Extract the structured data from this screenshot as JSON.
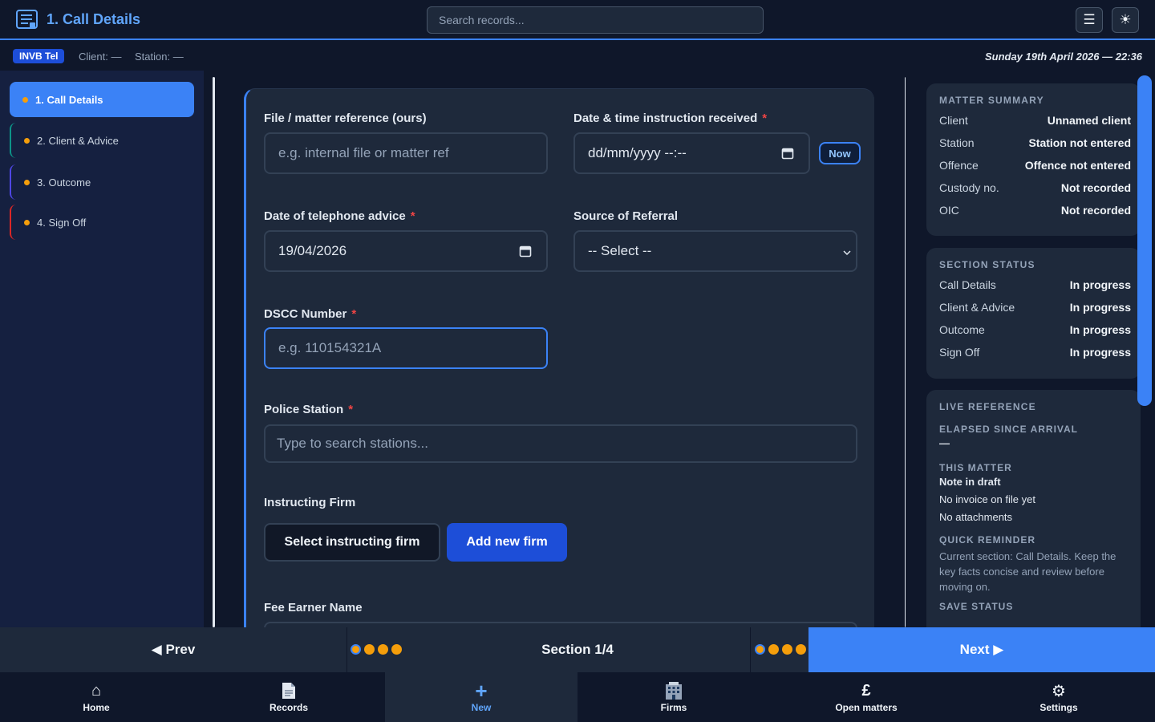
{
  "header": {
    "title": "1. Call Details",
    "search_placeholder": "Search records...",
    "menu_icon": "☰",
    "theme_icon": "☀"
  },
  "infobar": {
    "badge": "INVB Tel",
    "client": "Client: —",
    "station": "Station: —",
    "date": "Sunday 19th April 2026 — 22:36"
  },
  "sidebar": {
    "items": [
      {
        "label": "1. Call Details"
      },
      {
        "label": "2. Client & Advice"
      },
      {
        "label": "3. Outcome"
      },
      {
        "label": "4. Sign Off"
      }
    ]
  },
  "form": {
    "file_ref_label": "File / matter reference (ours)",
    "file_ref_placeholder": "e.g. internal file or matter ref",
    "instruction_label": "Date & time instruction received",
    "instruction_value": "dd/mm/yyyy --:--",
    "now_label": "Now",
    "tel_advice_label": "Date of telephone advice",
    "tel_advice_value": "19/04/2026",
    "referral_label": "Source of Referral",
    "referral_value": "-- Select --",
    "dscc_label": "DSCC Number",
    "dscc_placeholder": "e.g. 110154321A",
    "police_label": "Police Station",
    "police_placeholder": "Type to search stations...",
    "firm_label": "Instructing Firm",
    "select_firm": "Select instructing firm",
    "add_firm": "Add new firm",
    "fee_earner_label": "Fee Earner Name",
    "required_mark": "*"
  },
  "summary": {
    "title": "MATTER SUMMARY",
    "rows": [
      {
        "k": "Client",
        "v": "Unnamed client"
      },
      {
        "k": "Station",
        "v": "Station not entered"
      },
      {
        "k": "Offence",
        "v": "Offence not entered"
      },
      {
        "k": "Custody no.",
        "v": "Not recorded"
      },
      {
        "k": "OIC",
        "v": "Not recorded"
      }
    ]
  },
  "status": {
    "title": "SECTION STATUS",
    "rows": [
      {
        "k": "Call Details",
        "v": "In progress"
      },
      {
        "k": "Client & Advice",
        "v": "In progress"
      },
      {
        "k": "Outcome",
        "v": "In progress"
      },
      {
        "k": "Sign Off",
        "v": "In progress"
      }
    ]
  },
  "live": {
    "title": "LIVE REFERENCE",
    "elapsed_title": "ELAPSED SINCE ARRIVAL",
    "elapsed_value": "—",
    "matter_title": "THIS MATTER",
    "matter_draft": "Note in draft",
    "matter_invoice": "No invoice on file yet",
    "matter_attach": "No attachments",
    "reminder_title": "QUICK REMINDER",
    "reminder_text": "Current section: Call Details. Keep the key facts concise and review before moving on.",
    "save_title": "SAVE STATUS"
  },
  "wizard": {
    "prev": "◀ Prev",
    "section": "Section 1/4",
    "next": "Next ▶"
  },
  "bottomnav": {
    "items": [
      {
        "label": "Home",
        "icon": "⌂"
      },
      {
        "label": "Records",
        "icon": "doc"
      },
      {
        "label": "New",
        "icon": "+"
      },
      {
        "label": "Firms",
        "icon": "building"
      },
      {
        "label": "Open matters",
        "icon": "£"
      },
      {
        "label": "Settings",
        "icon": "⚙"
      }
    ]
  },
  "colors": {
    "accent": "#3b82f6",
    "background": "#0f172a",
    "card": "#1e293b",
    "dot": "#f59e0b",
    "required": "#ef4444"
  }
}
